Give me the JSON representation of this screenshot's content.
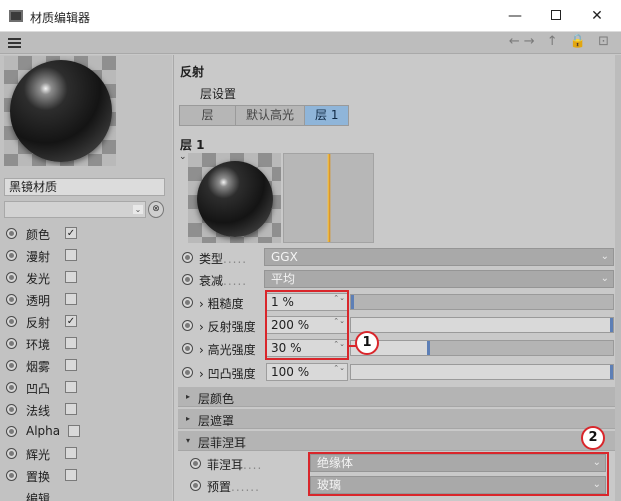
{
  "window": {
    "title": "材质编辑器",
    "minimize": "—",
    "close": "✕"
  },
  "toolbar": {
    "nav_icons": "←→ ↑ 🔒 ⊡"
  },
  "material": {
    "name": "黑镜材质",
    "dropdown_value": "",
    "dropdown_arrow": "⌄",
    "picker_icon": "⊗"
  },
  "channels": [
    {
      "label": "颜色",
      "check": "✓"
    },
    {
      "label": "漫射",
      "check": ""
    },
    {
      "label": "发光",
      "check": ""
    },
    {
      "label": "透明",
      "check": ""
    },
    {
      "label": "反射",
      "check": "✓"
    },
    {
      "label": "环境",
      "check": ""
    },
    {
      "label": "烟雾",
      "check": ""
    },
    {
      "label": "凹凸",
      "check": ""
    },
    {
      "label": "法线",
      "check": ""
    },
    {
      "label": "Alpha",
      "check": ""
    },
    {
      "label": "辉光",
      "check": ""
    },
    {
      "label": "置换",
      "check": ""
    },
    {
      "label": "编辑",
      "check": ""
    }
  ],
  "reflection": {
    "section_title": "反射",
    "subsection": "层设置",
    "tabs": [
      "层",
      "默认高光",
      "层 1"
    ],
    "active_tab": "层 1",
    "layer_title": "层 1",
    "collapse_arrow": "⌄"
  },
  "params": {
    "type": {
      "label": "类型",
      "dots": ".....",
      "value": "GGX",
      "chev": "⌄"
    },
    "falloff": {
      "label": "衰减",
      "dots": ".....",
      "value": "平均",
      "chev": "⌄"
    },
    "roughness": {
      "label": "› 粗糙度",
      "dots": "",
      "value": "1 %",
      "spin": "⌃⌄",
      "fill_fraction": 0.01
    },
    "reflect_strength": {
      "label": "› 反射强度",
      "dots": "",
      "value": "200 %",
      "spin": "⌃⌄",
      "fill_fraction": 1.0
    },
    "specular_strength": {
      "label": "› 高光强度",
      "dots": "",
      "value": "30 %",
      "spin": "⌃⌄",
      "fill_fraction": 0.3
    },
    "bump_strength": {
      "label": "› 凹凸强度",
      "dots": "",
      "value": "100 %",
      "spin": "⌃⌄",
      "fill_fraction": 1.0
    }
  },
  "folds": {
    "layer_color": {
      "tri": "▸",
      "label": "层颜色"
    },
    "layer_mask": {
      "tri": "▸",
      "label": "层遮罩"
    },
    "layer_fresnel": {
      "tri": "▾",
      "label": "层菲涅耳"
    }
  },
  "fresnel": {
    "fresnel": {
      "label": "菲涅耳",
      "dots": "....",
      "value": "绝缘体",
      "chev": "⌄"
    },
    "preset": {
      "label": "预置",
      "dots": "......",
      "value": "玻璃",
      "chev": "⌄"
    }
  },
  "annotations": {
    "badge1": "1",
    "badge2": "2",
    "color": "#d9262b"
  },
  "colors": {
    "active_tab": "#8fb5d9",
    "slider_knob": "#5d7fb6",
    "curve": "#f4c24a"
  }
}
